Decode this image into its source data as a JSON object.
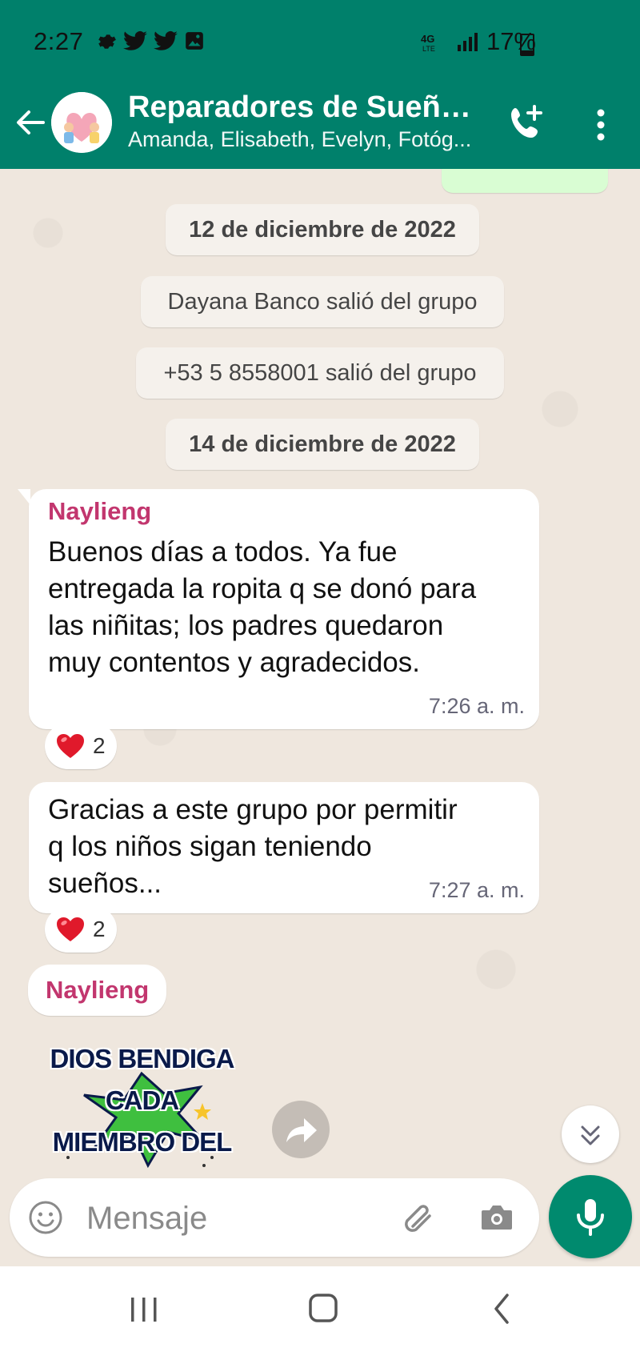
{
  "status_bar": {
    "time": "2:27",
    "battery": "17%",
    "network": "4G LTE"
  },
  "header": {
    "title": "Reparadores de Sueño...",
    "subtitle": "Amanda, Elisabeth, Evelyn, Fotóg...",
    "avatar_text": "Reparadores de Sueños"
  },
  "chat": {
    "system": {
      "date_1": "12 de diciembre de 2022",
      "left_1": "Dayana Banco salió del grupo",
      "left_2": "+53 5 8558001 salió del grupo",
      "date_2": "14 de diciembre de 2022"
    },
    "message_1": {
      "sender": "Naylieng",
      "lines": [
        "Buenos días a todos. Ya fue",
        "entregada la ropita q se donó para",
        "las niñitas; los padres quedaron",
        "muy contentos y agradecidos."
      ],
      "time": "7:26 a. m.",
      "reaction_count": "2"
    },
    "message_2": {
      "lines": [
        "Gracias a este grupo por permitir",
        "q los niños sigan teniendo",
        "sueños..."
      ],
      "time": "7:27 a. m.",
      "reaction_count": "2"
    },
    "message_3": {
      "sender": "Naylieng",
      "sticker_lines": [
        "DIOS BENDIGA",
        "CADA",
        "MIEMBRO DEL"
      ]
    }
  },
  "input": {
    "placeholder": "Mensaje"
  },
  "colors": {
    "header": "#00806b",
    "chat_bg": "#efe7de",
    "sender": "#c2366e",
    "mic": "#008a6e"
  },
  "icons": [
    "back-arrow-icon",
    "add-call-icon",
    "more-vert-icon",
    "emoji-icon",
    "attach-icon",
    "camera-icon",
    "mic-icon",
    "forward-icon",
    "scroll-down-icon",
    "heart-icon"
  ]
}
